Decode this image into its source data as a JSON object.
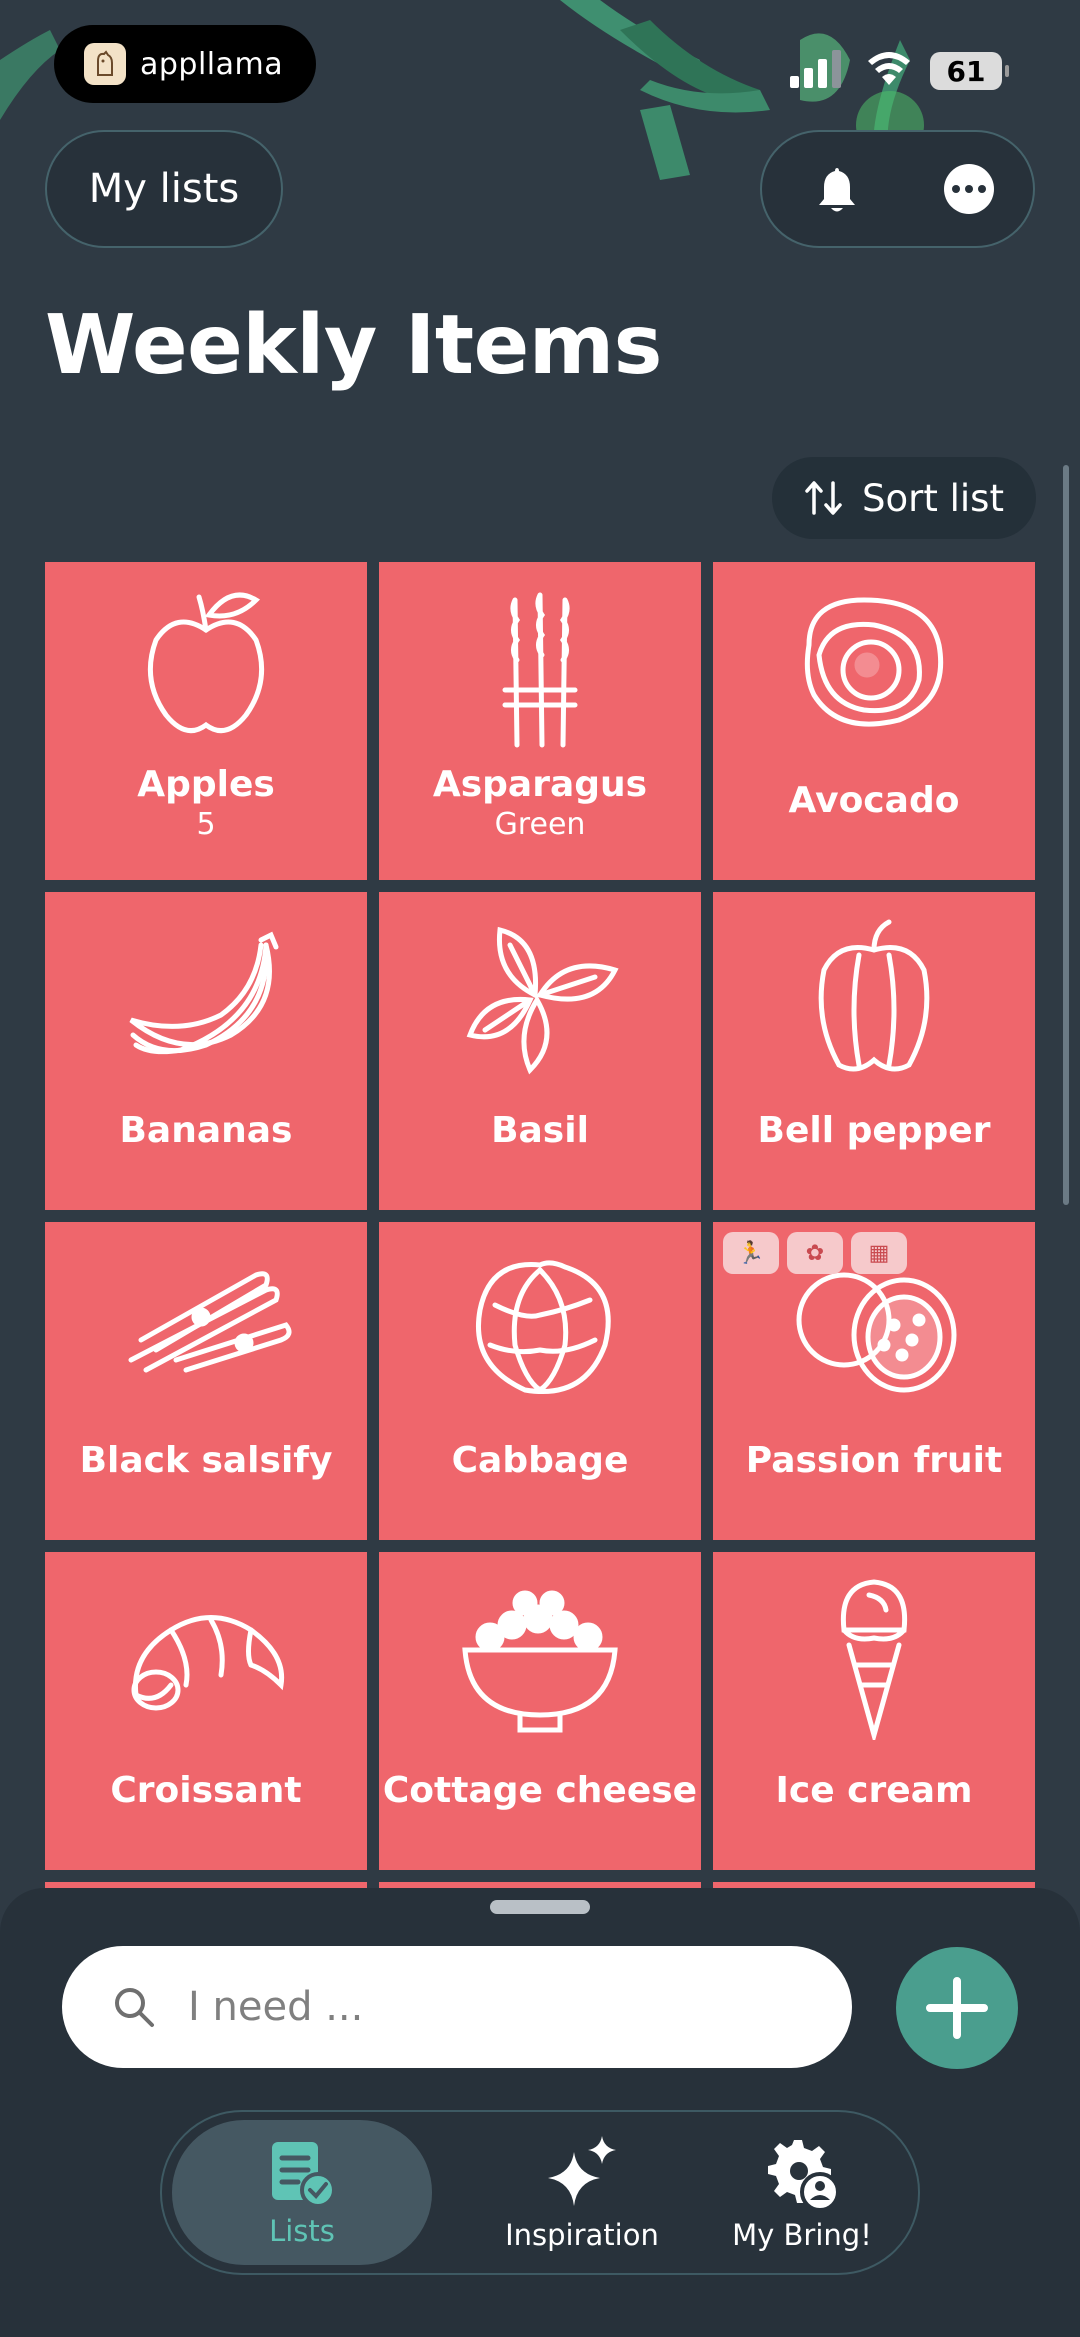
{
  "status_bar": {
    "app_name": "appllama",
    "battery": "61"
  },
  "header": {
    "my_lists_label": "My lists",
    "title": "Weekly Items",
    "sort_label": "Sort list"
  },
  "items": [
    {
      "name": "Apples",
      "spec": "5",
      "icon": "apple-icon"
    },
    {
      "name": "Asparagus",
      "spec": "Green",
      "icon": "asparagus-icon"
    },
    {
      "name": "Avocado",
      "spec": "",
      "icon": "avocado-icon"
    },
    {
      "name": "Bananas",
      "spec": "",
      "icon": "banana-icon"
    },
    {
      "name": "Basil",
      "spec": "",
      "icon": "basil-icon"
    },
    {
      "name": "Bell pepper",
      "spec": "",
      "icon": "bell-pepper-icon"
    },
    {
      "name": "Black salsify",
      "spec": "",
      "icon": "salsify-icon"
    },
    {
      "name": "Cabbage",
      "spec": "",
      "icon": "cabbage-icon"
    },
    {
      "name": "Passion fruit",
      "spec": "",
      "icon": "passion-fruit-icon"
    },
    {
      "name": "Croissant",
      "spec": "",
      "icon": "croissant-icon"
    },
    {
      "name": "Cottage cheese",
      "spec": "",
      "icon": "cottage-cheese-icon"
    },
    {
      "name": "Ice cream",
      "spec": "",
      "icon": "ice-cream-icon"
    }
  ],
  "search": {
    "placeholder": "I need ..."
  },
  "nav": {
    "lists": "Lists",
    "inspiration": "Inspiration",
    "my_bring": "My Bring!"
  },
  "colors": {
    "background": "#2f3a44",
    "tile": "#ef666c",
    "accent": "#4a9e8e",
    "active_nav": "#5fc4b5"
  }
}
